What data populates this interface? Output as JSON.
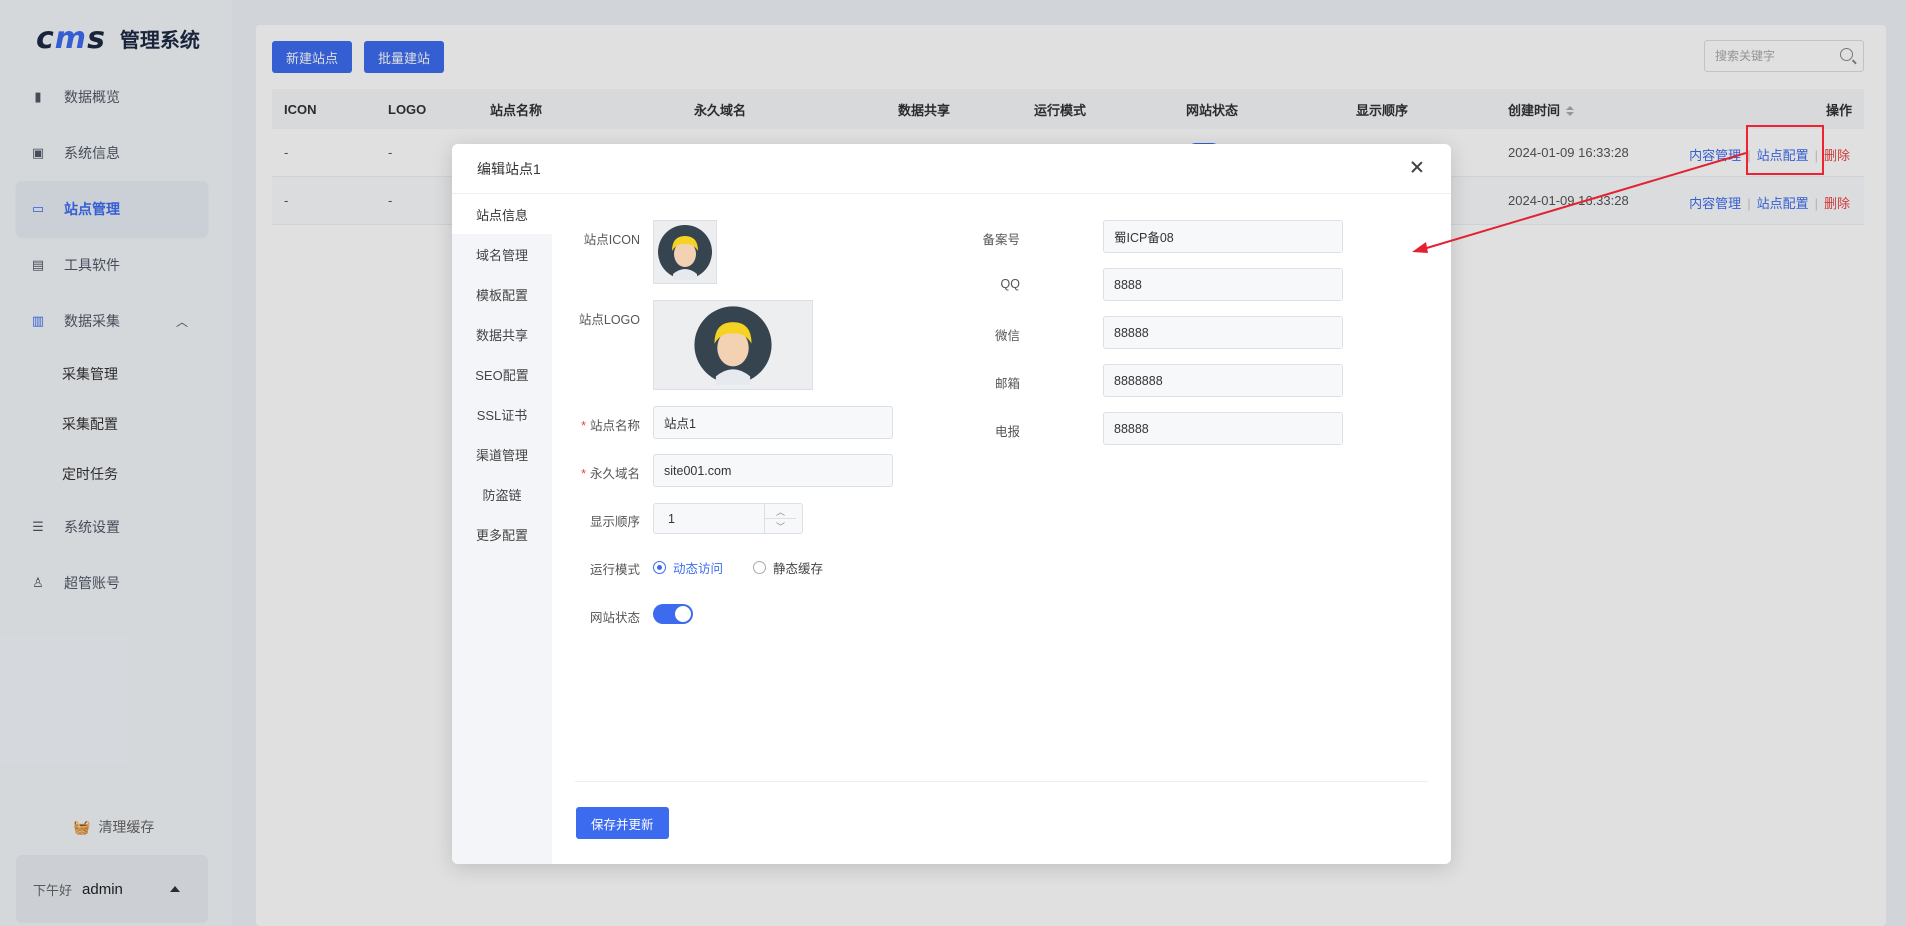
{
  "app": {
    "logo_text_a": "c",
    "logo_text_m": "m",
    "logo_text_b": "s",
    "title": "管理系统"
  },
  "sidebar": {
    "items": [
      {
        "label": "数据概览",
        "icon": "bar-chart-icon"
      },
      {
        "label": "系统信息",
        "icon": "chip-icon"
      },
      {
        "label": "站点管理",
        "icon": "monitor-icon"
      },
      {
        "label": "工具软件",
        "icon": "window-icon"
      },
      {
        "label": "数据采集",
        "icon": "save-icon"
      },
      {
        "label": "系统设置",
        "icon": "settings-icon"
      },
      {
        "label": "超管账号",
        "icon": "user-icon"
      }
    ],
    "sub_items": [
      "采集管理",
      "采集配置",
      "定时任务"
    ],
    "clear_cache": "清理缓存",
    "greeting": "下午好",
    "username": "admin"
  },
  "toolbar": {
    "new_site": "新建站点",
    "batch_build": "批量建站",
    "search_placeholder": "搜索关键字"
  },
  "table": {
    "headers": [
      "ICON",
      "LOGO",
      "站点名称",
      "永久域名",
      "数据共享",
      "运行模式",
      "网站状态",
      "显示顺序",
      "创建时间",
      "操作"
    ],
    "rows": [
      {
        "icon": "-",
        "logo": "-",
        "created": "2024-01-09 16:33:28"
      },
      {
        "icon": "-",
        "logo": "-",
        "created": "2024-01-09 16:33:28"
      }
    ],
    "actions": {
      "content": "内容管理",
      "config": "站点配置",
      "delete": "删除"
    }
  },
  "modal": {
    "title": "编辑站点1",
    "tabs": [
      "站点信息",
      "域名管理",
      "模板配置",
      "数据共享",
      "SEO配置",
      "SSL证书",
      "渠道管理",
      "防盗链",
      "更多配置"
    ],
    "labels": {
      "icon": "站点ICON",
      "logo": "站点LOGO",
      "name": "站点名称",
      "domain": "永久域名",
      "order": "显示顺序",
      "mode": "运行模式",
      "status": "网站状态",
      "icp": "备案号",
      "qq": "QQ",
      "wechat": "微信",
      "email": "邮箱",
      "telegram": "电报"
    },
    "values": {
      "name": "站点1",
      "domain": "site001.com",
      "order": "1",
      "icp": "蜀ICP备08",
      "qq": "8888",
      "wechat": "88888",
      "email": "8888888",
      "telegram": "88888"
    },
    "mode_options": [
      "动态访问",
      "静态缓存"
    ],
    "mode_selected": "动态访问",
    "status_on": true,
    "save_label": "保存并更新"
  },
  "colors": {
    "accent": "#3c6bf0",
    "danger": "#ee4444",
    "annotation": "#e22233"
  }
}
